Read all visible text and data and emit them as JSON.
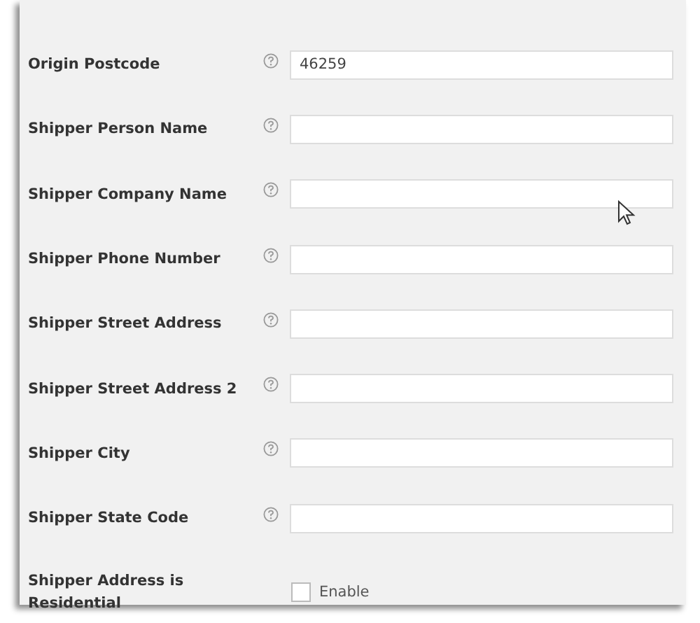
{
  "fields": [
    {
      "kind": "text",
      "label": "Origin Postcode",
      "value": "46259"
    },
    {
      "kind": "text",
      "label": "Shipper Person Name"
    },
    {
      "kind": "text",
      "label": "Shipper Company Name"
    },
    {
      "kind": "text",
      "label": "Shipper Phone Number"
    },
    {
      "kind": "text",
      "label": "Shipper Street Address"
    },
    {
      "kind": "text",
      "label": "Shipper Street Address 2"
    },
    {
      "kind": "text",
      "label": "Shipper City"
    },
    {
      "kind": "text",
      "label": "Shipper State Code"
    },
    {
      "kind": "checkbox",
      "label": "Shipper Address is Residential",
      "option": "Enable",
      "checked": false
    }
  ]
}
